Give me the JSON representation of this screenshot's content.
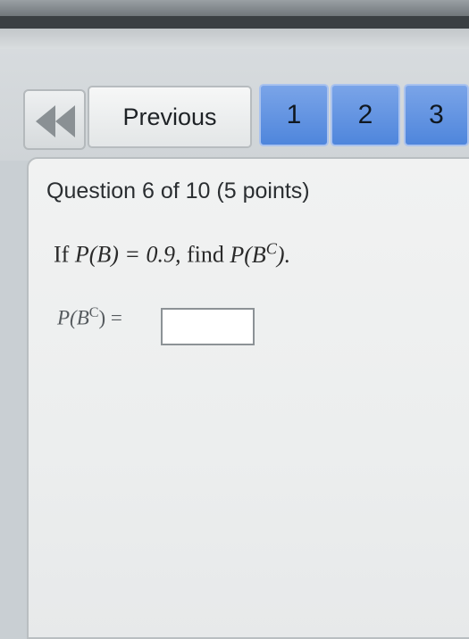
{
  "nav": {
    "back_icon": "double-left-arrow-icon",
    "previous_label": "Previous",
    "pages": [
      "1",
      "2",
      "3"
    ]
  },
  "question": {
    "header": "Question 6 of 10 (5 points)",
    "text_prefix": "If",
    "text_given": "P(B) = 0.9,",
    "text_find": "find",
    "text_target": "P(B",
    "text_superscript": "C",
    "text_close": ")."
  },
  "answer": {
    "label_main": "P(B",
    "label_superscript": "C",
    "label_close": ") =",
    "value": ""
  },
  "colors": {
    "page_button": "#4f86dc",
    "card_bg": "#eceeee"
  }
}
